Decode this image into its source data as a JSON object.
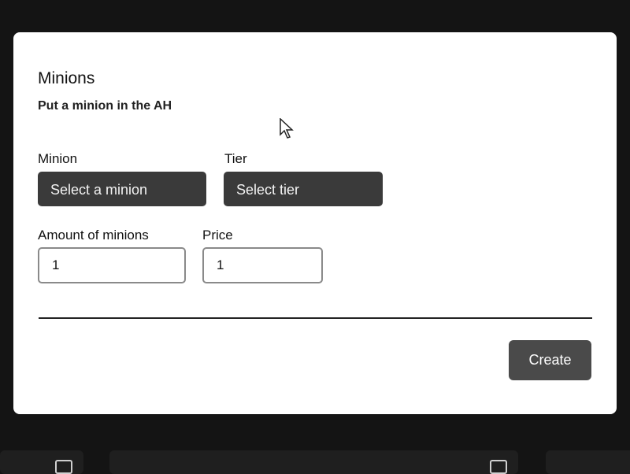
{
  "modal": {
    "title": "Minions",
    "subtitle": "Put a minion in the AH",
    "minion_label": "Minion",
    "minion_select": "Select a minion",
    "tier_label": "Tier",
    "tier_select": "Select tier",
    "amount_label": "Amount of minions",
    "amount_value": "1",
    "price_label": "Price",
    "price_value": "1",
    "create_button": "Create"
  },
  "icons": [
    "trash-icon",
    "mouse-cursor-icon"
  ]
}
